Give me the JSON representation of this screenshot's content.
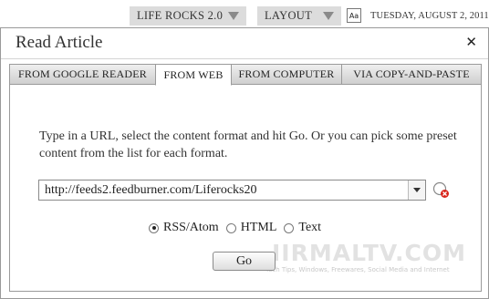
{
  "topbar": {
    "theme_label": "LIFE ROCKS 2.0",
    "layout_label": "LAYOUT",
    "text_size_label": "Aa",
    "date": "TUESDAY, AUGUST 2, 2011"
  },
  "dialog": {
    "title": "Read Article",
    "close_label": "✕",
    "tabs": [
      {
        "label": "FROM GOOGLE READER",
        "active": false
      },
      {
        "label": "FROM WEB",
        "active": true
      },
      {
        "label": "FROM COMPUTER",
        "active": false
      },
      {
        "label": "VIA COPY-AND-PASTE",
        "active": false
      }
    ],
    "description": "Type in a URL, select the content format and hit Go. Or you can pick some preset content from the list for each format.",
    "url_value": "http://feeds2.feedburner.com/Liferocks20",
    "formats": [
      {
        "label": "RSS/Atom",
        "selected": true
      },
      {
        "label": "HTML",
        "selected": false
      },
      {
        "label": "Text",
        "selected": false
      }
    ],
    "go_label": "Go"
  },
  "watermark": {
    "main": "IIRMALTV.COM",
    "sub": "Tech Tips, Windows, Freewares, Social Media and Internet"
  }
}
